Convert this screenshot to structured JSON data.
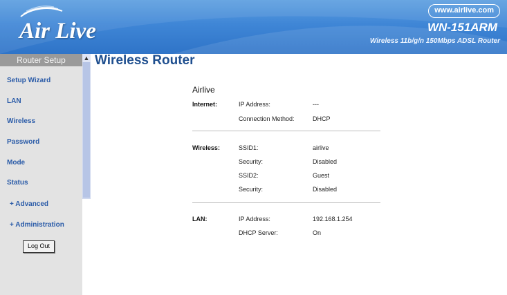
{
  "header": {
    "logo_text": "Air Live",
    "url_badge": "www.airlive.com",
    "model": "WN-151ARM",
    "tagline": "Wireless 11b/g/n 150Mbps ADSL Router"
  },
  "sidebar": {
    "title": "Router Setup",
    "items": [
      {
        "label": "Setup Wizard"
      },
      {
        "label": "LAN"
      },
      {
        "label": "Wireless"
      },
      {
        "label": "Password"
      },
      {
        "label": "Mode"
      },
      {
        "label": "Status"
      },
      {
        "label": "+ Advanced"
      },
      {
        "label": "+ Administration"
      }
    ],
    "logout_label": "Log Out"
  },
  "main": {
    "title": "Wireless Router",
    "device_name": "Airlive",
    "internet": {
      "label": "Internet:",
      "ip_label": "IP Address:",
      "ip_value": "---",
      "method_label": "Connection Method:",
      "method_value": "DHCP"
    },
    "wireless": {
      "label": "Wireless:",
      "ssid1_label": "SSID1:",
      "ssid1_value": "airlive",
      "security1_label": "Security:",
      "security1_value": "Disabled",
      "ssid2_label": "SSID2:",
      "ssid2_value": "Guest",
      "security2_label": "Security:",
      "security2_value": "Disabled"
    },
    "lan": {
      "label": "LAN:",
      "ip_label": "IP Address:",
      "ip_value": "192.168.1.254",
      "dhcp_label": "DHCP Server:",
      "dhcp_value": "On"
    }
  },
  "colors": {
    "header_blue": "#3f86d6",
    "nav_link": "#2a5ba8",
    "title_blue": "#1f4f8f",
    "sidebar_bg": "#e3e3e3"
  }
}
